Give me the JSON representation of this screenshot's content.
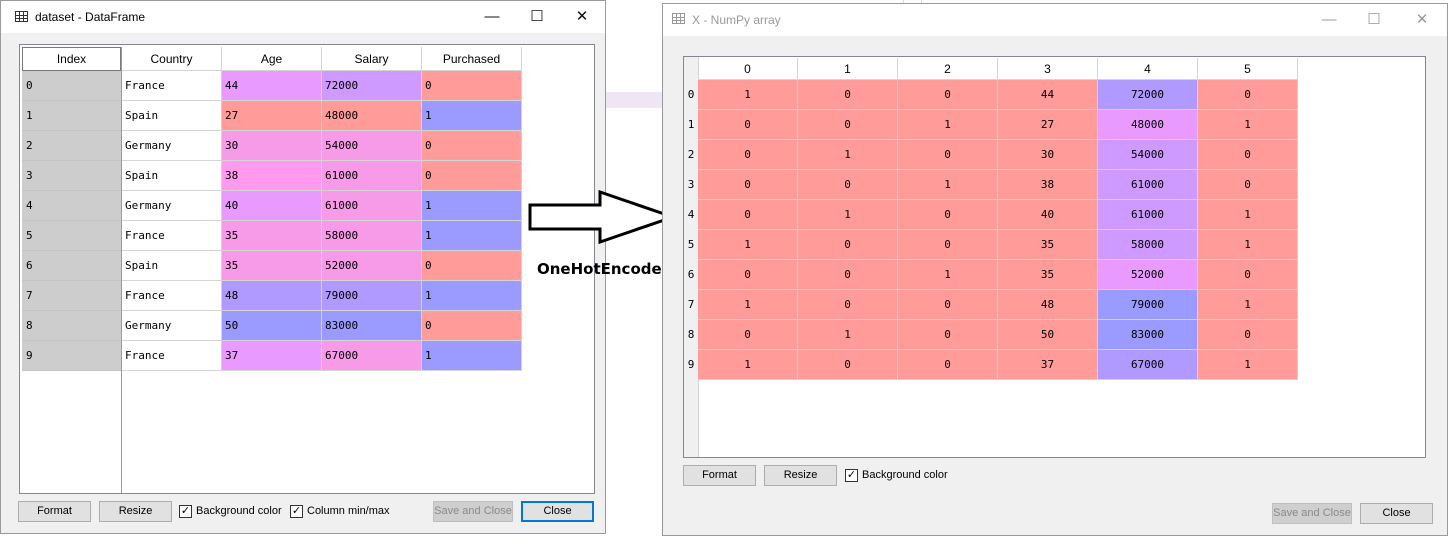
{
  "colors": {
    "red": "#ff9c9a",
    "blue": "#9a9aff",
    "purple": "#cf9aff",
    "magenta": "#ff9aee",
    "pink": "#f79ae8",
    "violet": "#e99aff",
    "lavender": "#b09aff",
    "index_bg": "#cdcdcd"
  },
  "dataframe_window": {
    "title": "dataset - DataFrame",
    "window_icon": "table-grid-icon",
    "controls": {
      "minimize": "—",
      "maximize": "☐",
      "close": "✕"
    },
    "index_header": "Index",
    "columns": [
      "Country",
      "Age",
      "Salary",
      "Purchased"
    ],
    "index": [
      "0",
      "1",
      "2",
      "3",
      "4",
      "5",
      "6",
      "7",
      "8",
      "9"
    ],
    "rows": [
      [
        "France",
        "44",
        "72000",
        "0"
      ],
      [
        "Spain",
        "27",
        "48000",
        "1"
      ],
      [
        "Germany",
        "30",
        "54000",
        "0"
      ],
      [
        "Spain",
        "38",
        "61000",
        "0"
      ],
      [
        "Germany",
        "40",
        "61000",
        "1"
      ],
      [
        "France",
        "35",
        "58000",
        "1"
      ],
      [
        "Spain",
        "35",
        "52000",
        "0"
      ],
      [
        "France",
        "48",
        "79000",
        "1"
      ],
      [
        "Germany",
        "50",
        "83000",
        "0"
      ],
      [
        "France",
        "37",
        "67000",
        "1"
      ]
    ],
    "cell_colors": [
      [
        "",
        "violet",
        "purple",
        "red"
      ],
      [
        "",
        "red",
        "red",
        "blue"
      ],
      [
        "",
        "pink",
        "pink",
        "red"
      ],
      [
        "",
        "magenta",
        "pink",
        "red"
      ],
      [
        "",
        "violet",
        "pink",
        "blue"
      ],
      [
        "",
        "pink",
        "pink",
        "blue"
      ],
      [
        "",
        "pink",
        "pink",
        "red"
      ],
      [
        "",
        "lavender",
        "lavender",
        "blue"
      ],
      [
        "",
        "blue",
        "blue",
        "red"
      ],
      [
        "",
        "violet",
        "pink",
        "blue"
      ]
    ],
    "buttons": {
      "format": "Format",
      "resize": "Resize",
      "save_and_close": "Save and Close",
      "close": "Close"
    },
    "checkboxes": [
      {
        "label": "Background color",
        "checked": true
      },
      {
        "label": "Column min/max",
        "checked": true
      }
    ]
  },
  "arrow": {
    "caption": "OneHotEncoder",
    "icon": "right-arrow-icon"
  },
  "numpy_window": {
    "title": "X - NumPy array",
    "window_icon": "table-grid-icon",
    "controls": {
      "minimize": "—",
      "maximize": "☐",
      "close": "✕"
    },
    "columns": [
      "0",
      "1",
      "2",
      "3",
      "4",
      "5"
    ],
    "row_labels": [
      "0",
      "1",
      "2",
      "3",
      "4",
      "5",
      "6",
      "7",
      "8",
      "9"
    ],
    "rows": [
      [
        "1",
        "0",
        "0",
        "44",
        "72000",
        "0"
      ],
      [
        "0",
        "0",
        "1",
        "27",
        "48000",
        "1"
      ],
      [
        "0",
        "1",
        "0",
        "30",
        "54000",
        "0"
      ],
      [
        "0",
        "0",
        "1",
        "38",
        "61000",
        "0"
      ],
      [
        "0",
        "1",
        "0",
        "40",
        "61000",
        "1"
      ],
      [
        "1",
        "0",
        "0",
        "35",
        "58000",
        "1"
      ],
      [
        "0",
        "0",
        "1",
        "35",
        "52000",
        "0"
      ],
      [
        "1",
        "0",
        "0",
        "48",
        "79000",
        "1"
      ],
      [
        "0",
        "1",
        "0",
        "50",
        "83000",
        "0"
      ],
      [
        "1",
        "0",
        "0",
        "37",
        "67000",
        "1"
      ]
    ],
    "cell_colors": [
      [
        "red",
        "red",
        "red",
        "red",
        "lavender",
        "red"
      ],
      [
        "red",
        "red",
        "red",
        "red",
        "violet",
        "red"
      ],
      [
        "red",
        "red",
        "red",
        "red",
        "purple",
        "red"
      ],
      [
        "red",
        "red",
        "red",
        "red",
        "purple",
        "red"
      ],
      [
        "red",
        "red",
        "red",
        "red",
        "purple",
        "red"
      ],
      [
        "red",
        "red",
        "red",
        "red",
        "purple",
        "red"
      ],
      [
        "red",
        "red",
        "red",
        "red",
        "violet",
        "red"
      ],
      [
        "red",
        "red",
        "red",
        "red",
        "blue",
        "red"
      ],
      [
        "red",
        "red",
        "red",
        "red",
        "blue",
        "red"
      ],
      [
        "red",
        "red",
        "red",
        "red",
        "lavender",
        "red"
      ]
    ],
    "buttons": {
      "format": "Format",
      "resize": "Resize",
      "save_and_close": "Save and Close",
      "close": "Close"
    },
    "checkboxes": [
      {
        "label": "Background color",
        "checked": true
      }
    ]
  }
}
